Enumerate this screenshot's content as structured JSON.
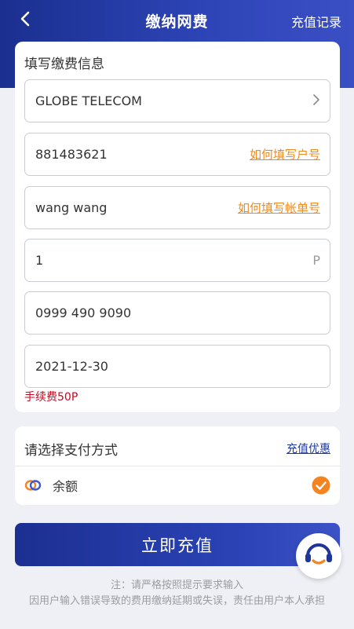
{
  "header": {
    "title": "缴纳网费",
    "records_label": "充值记录"
  },
  "form": {
    "section_title": "填写缴费信息",
    "provider": "GLOBE TELECOM",
    "account_number": "881483621",
    "account_help": "如何填写户号",
    "bill_name": "wang wang",
    "bill_help": "如何填写帐单号",
    "amount": "1",
    "amount_unit": "P",
    "phone": "0999 490 9090",
    "date": "2021-12-30",
    "fee_note": "手续费50P"
  },
  "payment": {
    "title": "请选择支付方式",
    "promo_label": "充值优惠",
    "method_label": "余额"
  },
  "submit_label": "立即充值",
  "notes": {
    "line1": "注：请严格按照提示要求输入",
    "line2": "因用户输入错误导致的费用缴纳延期或失误，责任由用户本人承担"
  },
  "colors": {
    "brand": "#1f3597",
    "link_orange": "#f08a1c",
    "fee_red": "#d0021b",
    "check_orange": "#f5831f"
  },
  "icons": [
    "back-arrow-icon",
    "chevron-right-icon",
    "balance-icon",
    "check-circle-icon",
    "customer-service-icon"
  ]
}
